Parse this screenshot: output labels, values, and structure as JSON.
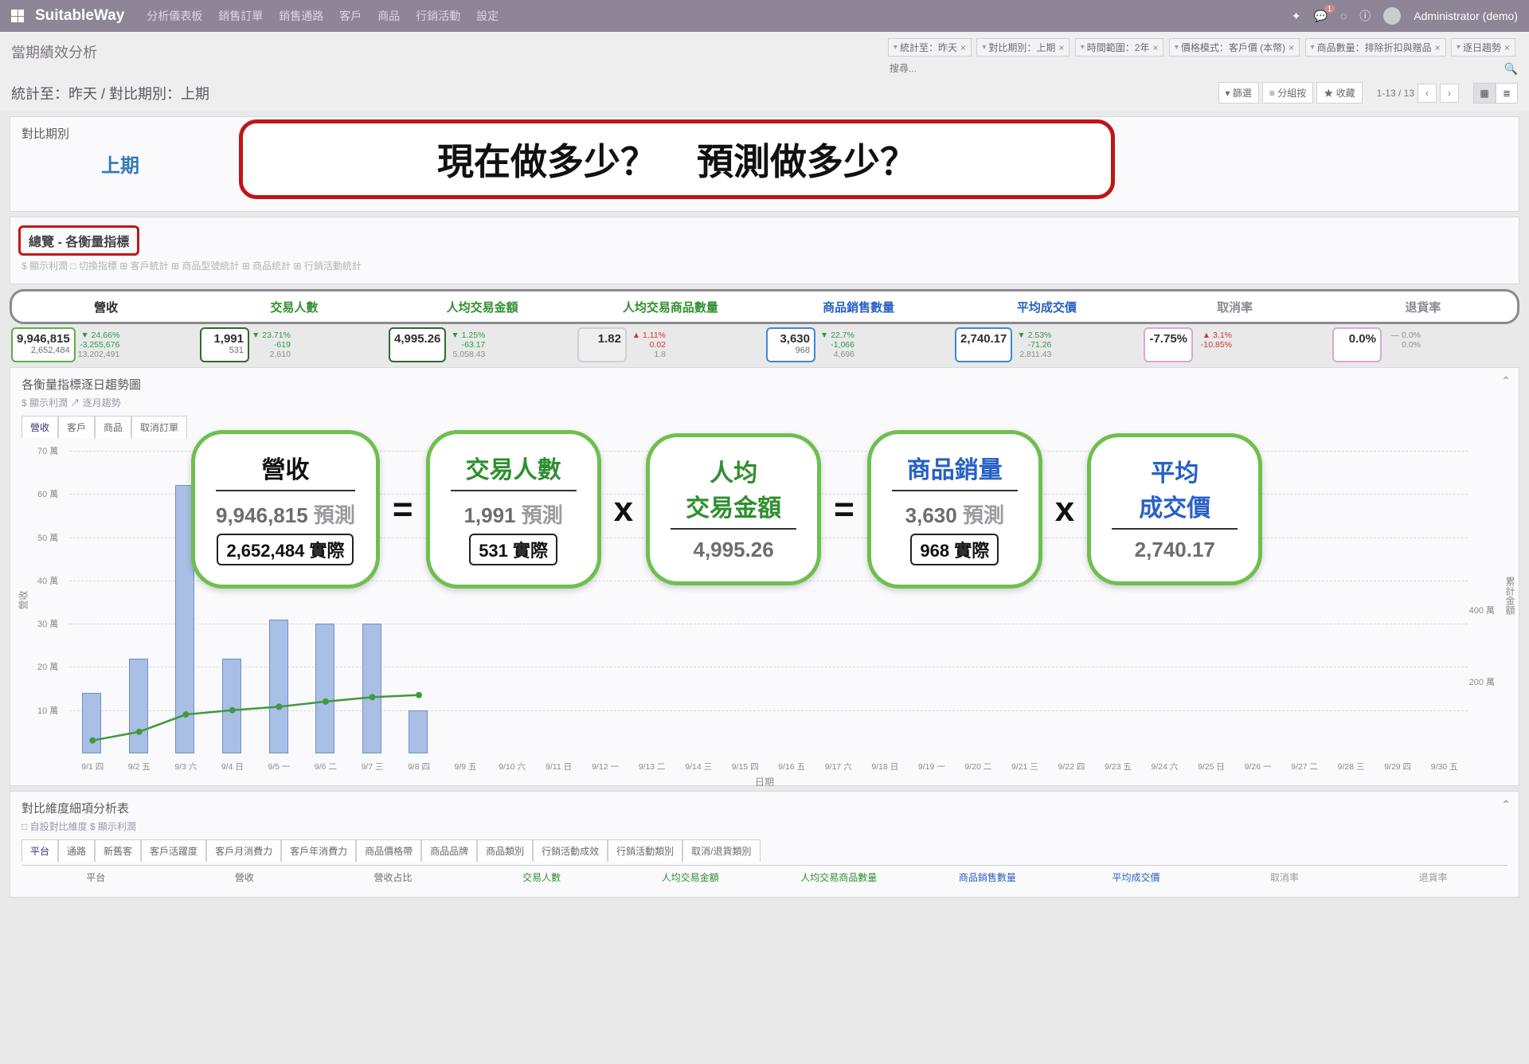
{
  "nav": {
    "brand": "SuitableWay",
    "menu": [
      "分析儀表板",
      "銷售訂單",
      "銷售通路",
      "客戶",
      "商品",
      "行銷活動",
      "設定"
    ],
    "msg_count": "1",
    "user": "Administrator (demo)"
  },
  "page": {
    "title": "當期績效分析",
    "crumb": "統計至：昨天 / 對比期別：上期",
    "filters": [
      "統計至：昨天",
      "對比期別：上期",
      "時間範圍：2年",
      "價格模式：客戶價 (本幣)",
      "商品數量：排除折扣與贈品",
      "逐日趨勢"
    ],
    "search_ph": "搜尋...",
    "btn_filter": "篩選",
    "btn_group": "分組按",
    "btn_fav": "收藏",
    "pager": "1-13 / 13"
  },
  "period": {
    "label": "對比期別",
    "value": "上期"
  },
  "banner": {
    "left": "現在做多少？",
    "right": "預測做多少？"
  },
  "overview": {
    "title": "總覽 - 各衡量指標",
    "sub": "$ 顯示利潤   □ 切換指標   ⊞ 客戶統計   ⊞ 商品型號統計   ⊞ 商品統計   ⊞ 行銷活動統計",
    "headers": [
      {
        "t": "營收",
        "c": "c-blk"
      },
      {
        "t": "交易人數",
        "c": "c-grn"
      },
      {
        "t": "人均交易金額",
        "c": "c-grn"
      },
      {
        "t": "人均交易商品數量",
        "c": "c-grn"
      },
      {
        "t": "商品銷售數量",
        "c": "c-blu"
      },
      {
        "t": "平均成交價",
        "c": "c-blu"
      },
      {
        "t": "取消率",
        "c": "c-gry"
      },
      {
        "t": "退貨率",
        "c": "c-gry"
      }
    ]
  },
  "cards": [
    {
      "bd": "bd-grn",
      "big": "9,946,815",
      "small": "2,652,484",
      "d_pct": "▼ 24.66%",
      "d_v": "-3,255,676",
      "d_b": "13,202,491",
      "dir": "dn"
    },
    {
      "bd": "bd-dg",
      "big": "1,991",
      "small": "531",
      "d_pct": "▼ 23.71%",
      "d_v": "-619",
      "d_b": "2,610",
      "dir": "dn"
    },
    {
      "bd": "bd-dg",
      "big": "4,995.26",
      "small": "",
      "d_pct": "▼ 1.25%",
      "d_v": "-63.17",
      "d_b": "5,058.43",
      "dir": "dn"
    },
    {
      "bd": "bd-gr",
      "big": "1.82",
      "small": "",
      "d_pct": "▲ 1.11%",
      "d_v": "0.02",
      "d_b": "1.8",
      "dir": "up"
    },
    {
      "bd": "bd-blu",
      "big": "3,630",
      "small": "968",
      "d_pct": "▼ 22.7%",
      "d_v": "-1,066",
      "d_b": "4,696",
      "dir": "dn"
    },
    {
      "bd": "bd-blu",
      "big": "2,740.17",
      "small": "",
      "d_pct": "▼ 2.53%",
      "d_v": "-71.26",
      "d_b": "2,811.43",
      "dir": "dn"
    },
    {
      "bd": "bd-pk",
      "big": "-7.75%",
      "small": "",
      "d_pct": "▲ 3.1%",
      "d_v": "-10.85%",
      "d_b": "",
      "dir": "up"
    },
    {
      "bd": "bd-pk",
      "big": "0.0%",
      "small": "",
      "d_pct": "— 0.0%",
      "d_v": "0.0%",
      "d_b": "",
      "dir": "mut"
    }
  ],
  "pills": [
    {
      "title": "營收",
      "cls": "",
      "pred": "9,946,815",
      "predl": "預測",
      "act": "2,652,484 實際"
    },
    {
      "op": "="
    },
    {
      "title": "交易人數",
      "cls": "grn",
      "pred": "1,991",
      "predl": "預測",
      "act": "531  實際"
    },
    {
      "op": "x"
    },
    {
      "title": "人均\n交易金額",
      "cls": "grn",
      "pred": "4,995.26",
      "predl": "",
      "act": ""
    },
    {
      "op": "="
    },
    {
      "title": "商品銷量",
      "cls": "blu",
      "pred": "3,630",
      "predl": "預測",
      "act": "968 實際"
    },
    {
      "op": "x"
    },
    {
      "title": "平均\n成交價",
      "cls": "blu",
      "pred": "2,740.17",
      "predl": "",
      "act": ""
    }
  ],
  "trend": {
    "title": "各衡量指標逐日趨勢圖",
    "opts": "$ 顯示利潤   ↗ 逐月趨勢",
    "tabs": [
      "營收",
      "客戶",
      "商品",
      "取消訂單"
    ],
    "ylabel": "營收",
    "xlabel": "日期",
    "y2label": "累計金額"
  },
  "chart_data": {
    "type": "bar+line",
    "ylabel": "營收",
    "xlabel": "日期",
    "y2label": "累計金額",
    "ylim": [
      0,
      70
    ],
    "yunit": "萬",
    "y2ticks": [
      200,
      400
    ],
    "categories": [
      "9/1 四",
      "9/2 五",
      "9/3 六",
      "9/4 日",
      "9/5 一",
      "9/6 二",
      "9/7 三",
      "9/8 四",
      "9/9 五",
      "9/10 六",
      "9/11 日",
      "9/12 一",
      "9/13 二",
      "9/14 三",
      "9/15 四",
      "9/16 五",
      "9/17 六",
      "9/18 日",
      "9/19 一",
      "9/20 二",
      "9/21 三",
      "9/22 四",
      "9/23 五",
      "9/24 六",
      "9/25 日",
      "9/26 一",
      "9/27 二",
      "9/28 三",
      "9/29 四",
      "9/30 五"
    ],
    "bars": [
      14,
      22,
      62,
      22,
      31,
      30,
      30,
      10,
      0,
      0,
      0,
      0,
      0,
      0,
      0,
      0,
      0,
      0,
      0,
      0,
      0,
      0,
      0,
      0,
      0,
      0,
      0,
      0,
      0,
      0
    ],
    "line_cumulative": [
      3,
      5,
      9,
      10,
      10.8,
      12,
      13,
      13.5
    ]
  },
  "detail": {
    "title": "對比維度細項分析表",
    "opts": "□ 自設對比維度   $ 顯示利潤",
    "tabs": [
      "平台",
      "通路",
      "新舊客",
      "客戶活躍度",
      "客戶月消費力",
      "客戶年消費力",
      "商品價格帶",
      "商品品牌",
      "商品類別",
      "行銷活動成效",
      "行銷活動類別",
      "取消/退貨類別"
    ],
    "cols": [
      {
        "t": "平台",
        "c": ""
      },
      {
        "t": "營收",
        "c": ""
      },
      {
        "t": "營收占比",
        "c": ""
      },
      {
        "t": "交易人數",
        "c": "grn"
      },
      {
        "t": "人均交易金額",
        "c": "grn"
      },
      {
        "t": "人均交易商品數量",
        "c": "grn"
      },
      {
        "t": "商品銷售數量",
        "c": "blu"
      },
      {
        "t": "平均成交價",
        "c": "blu"
      },
      {
        "t": "取消率",
        "c": "gry"
      },
      {
        "t": "退貨率",
        "c": "gry"
      }
    ]
  }
}
